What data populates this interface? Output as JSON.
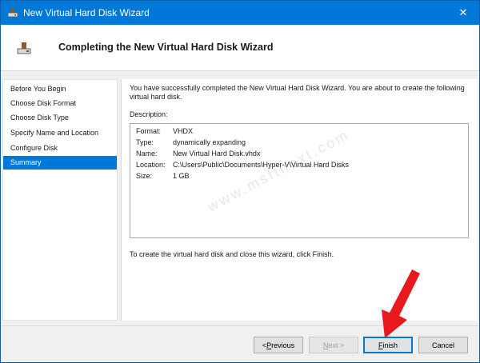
{
  "window": {
    "title": "New Virtual Hard Disk Wizard",
    "close_glyph": "✕"
  },
  "header": {
    "title": "Completing the New Virtual Hard Disk Wizard"
  },
  "sidebar": {
    "items": [
      {
        "label": "Before You Begin",
        "selected": false
      },
      {
        "label": "Choose Disk Format",
        "selected": false
      },
      {
        "label": "Choose Disk Type",
        "selected": false
      },
      {
        "label": "Specify Name and Location",
        "selected": false
      },
      {
        "label": "Configure Disk",
        "selected": false
      },
      {
        "label": "Summary",
        "selected": true
      }
    ]
  },
  "main": {
    "intro": "You have successfully completed the New Virtual Hard Disk Wizard. You are about to create the following virtual hard disk.",
    "description_label": "Description:",
    "description": [
      {
        "key": "Format:",
        "value": "VHDX"
      },
      {
        "key": "Type:",
        "value": "dynamically expanding"
      },
      {
        "key": "Name:",
        "value": "New Virtual Hard Disk.vhdx"
      },
      {
        "key": "Location:",
        "value": "C:\\Users\\Public\\Documents\\Hyper-V\\Virtual Hard Disks"
      },
      {
        "key": "Size:",
        "value": "1 GB"
      }
    ],
    "watermark": "www.msftnext.com",
    "finish_note": "To create the virtual hard disk and close this wizard, click Finish."
  },
  "buttons": {
    "previous_lt": "< ",
    "previous_hot": "P",
    "previous_rest": "revious",
    "next_hot": "N",
    "next_rest": "ext >",
    "finish_hot": "F",
    "finish_rest": "inish",
    "cancel": "Cancel",
    "next_enabled": false
  },
  "colors": {
    "title_bar": "#0078d7",
    "selection": "#0078d7",
    "arrow": "#e8191c"
  },
  "icons": {
    "app": "virtual-disk-icon",
    "header": "virtual-disk-icon",
    "close": "close-icon",
    "annotation": "red-arrow-icon"
  }
}
